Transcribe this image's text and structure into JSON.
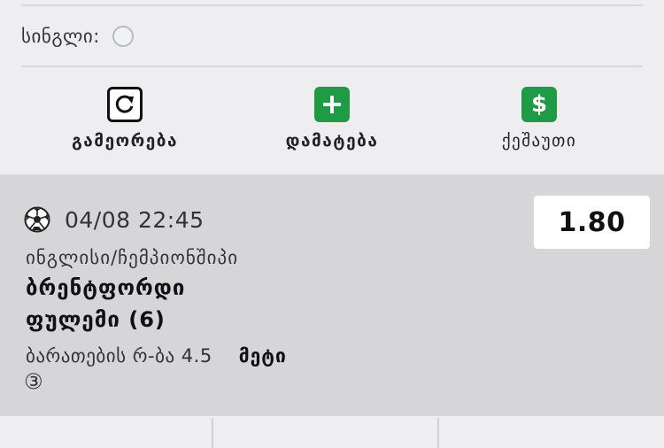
{
  "single": {
    "label": "სინგლი:"
  },
  "actions": [
    {
      "label": "გამეორება",
      "icon": "refresh-icon"
    },
    {
      "label": "დამატება",
      "icon": "plus-icon"
    },
    {
      "label": "ქეშაუთი",
      "icon": "dollar-icon"
    }
  ],
  "bet": {
    "datetime": "04/08 22:45",
    "league": "ინგლისი/ჩემპიონშიპი",
    "team_home": "ბრენტფორდი",
    "team_away": "ფულემი (6)",
    "market": "ბარათების რ-ბა 4.5",
    "outcome": "მეტი",
    "marker": "③",
    "odds": "1.80",
    "sport_icon": "soccer-ball-icon"
  },
  "colors": {
    "accent_green": "#1f9a45",
    "card_bg": "#d6d6d9",
    "page_bg": "#eeeef0"
  }
}
